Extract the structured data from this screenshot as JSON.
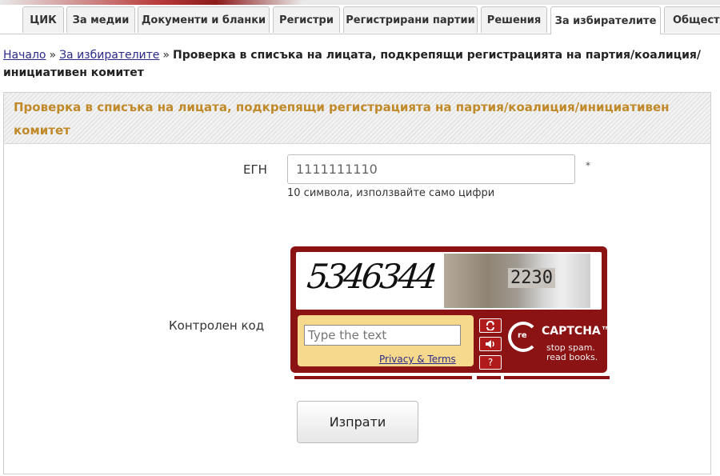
{
  "tabs": [
    {
      "label": "ЦИК"
    },
    {
      "label": "За медии"
    },
    {
      "label": "Документи и бланки"
    },
    {
      "label": "Регистри"
    },
    {
      "label": "Регистрирани партии"
    },
    {
      "label": "Решения"
    },
    {
      "label": "За избирателите"
    },
    {
      "label": "Общест"
    }
  ],
  "active_tab": "За избирателите",
  "breadcrumb": {
    "home": "Начало",
    "separator": "»",
    "parent": "За избирателите",
    "current": "Проверка в списъка на лицата, подкрепящи регистрацията на партия/коалиция/инициативен комитет"
  },
  "panel": {
    "title": "Проверка в списъка на лицата, подкрепящи регистрацията на партия/коалиция/инициативен комитет"
  },
  "form": {
    "egn_label": "ЕГН",
    "egn_value": "1111111110",
    "required_mark": "*",
    "egn_hint": "10 символа, използвайте само цифри",
    "captcha_label": "Контролен код",
    "submit_label": "Изпрати"
  },
  "captcha": {
    "word1": "5346344",
    "word2": "2230",
    "input_placeholder": "Type the text",
    "privacy_terms": "Privacy & Terms",
    "reload_icon": "reload-icon",
    "audio_icon": "audio-icon",
    "help_icon": "help-icon",
    "help_glyph": "?",
    "brand_re": "re",
    "brand_name": "CAPTCHA™",
    "tagline1": "stop spam.",
    "tagline2": "read books.",
    "accent_color": "#8b1313",
    "input_bg_color": "#f6d98c"
  },
  "colors": {
    "panel_title": "#c08a2a",
    "link": "#2a2a8a"
  }
}
